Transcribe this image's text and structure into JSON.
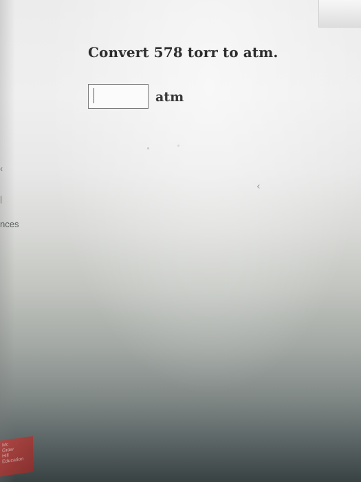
{
  "question": {
    "text": "Convert 578 torr to atm."
  },
  "answer": {
    "value": "",
    "placeholder": "",
    "unit": "atm"
  },
  "side_panel": {
    "label": "nces"
  },
  "logo": {
    "lines": [
      "Mc",
      "Graw",
      "Hill",
      "Education"
    ]
  }
}
